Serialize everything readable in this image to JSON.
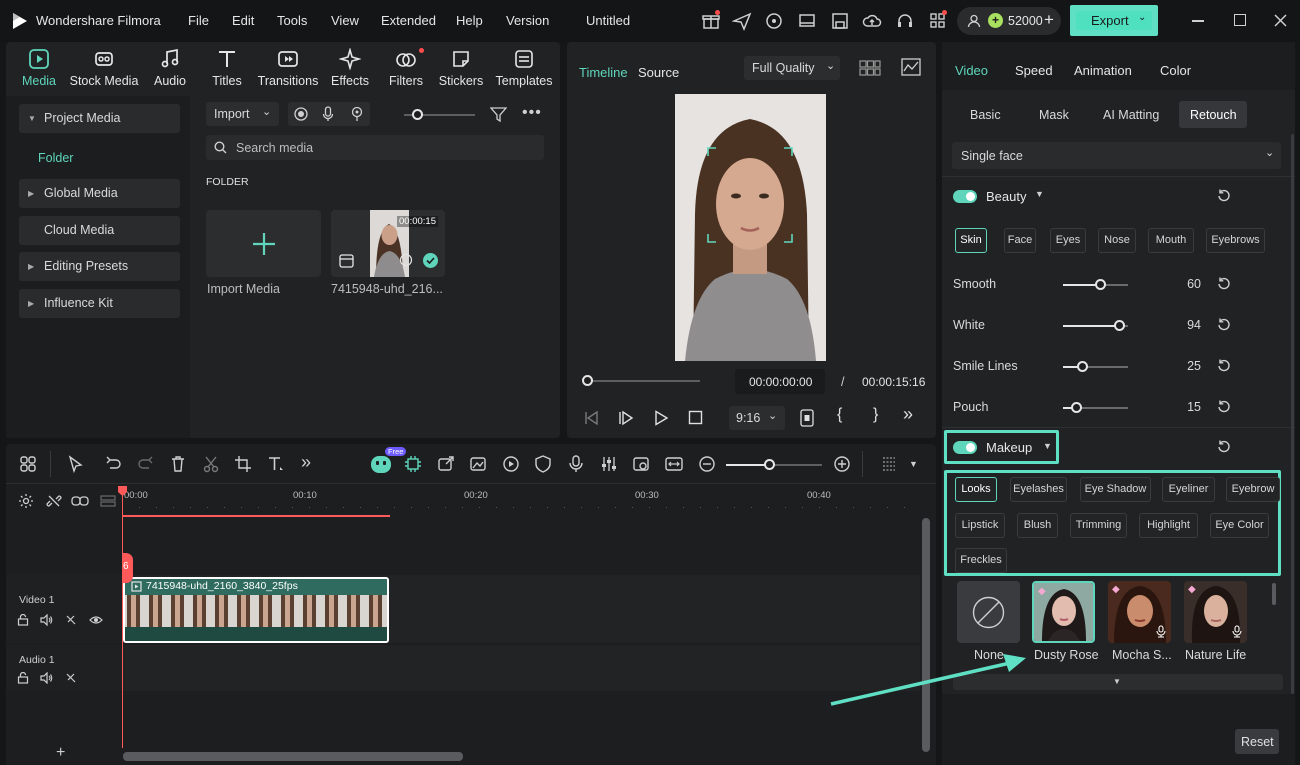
{
  "app": {
    "name": "Wondershare Filmora",
    "project_title": "Untitled",
    "credits": "52000"
  },
  "menu": [
    "File",
    "Edit",
    "Tools",
    "View",
    "Extended",
    "Help",
    "Version"
  ],
  "export_label": "Export",
  "tools": [
    "Media",
    "Stock Media",
    "Audio",
    "Titles",
    "Transitions",
    "Effects",
    "Filters",
    "Stickers",
    "Templates"
  ],
  "sidebar": {
    "items": [
      {
        "label": "Project Media"
      },
      {
        "label": "Folder"
      },
      {
        "label": "Global Media"
      },
      {
        "label": "Cloud Media"
      },
      {
        "label": "Editing Presets"
      },
      {
        "label": "Influence Kit"
      }
    ]
  },
  "media": {
    "import_label": "Import",
    "search_placeholder": "Search media",
    "folder_heading": "FOLDER",
    "import_tile_label": "Import Media",
    "clip_name": "7415948-uhd_216...",
    "clip_duration": "00:00:15"
  },
  "preview": {
    "tab_timeline": "Timeline",
    "tab_source": "Source",
    "quality": "Full Quality",
    "current_time": "00:00:00:00",
    "separator": "/",
    "total_time": "00:00:15:16",
    "aspect": "9:16",
    "progress": 0
  },
  "properties": {
    "tabs": [
      "Video",
      "Speed",
      "Animation",
      "Color"
    ],
    "subtabs": [
      "Basic",
      "Mask",
      "AI Matting",
      "Retouch"
    ],
    "face_mode": "Single face",
    "beauty": {
      "label": "Beauty",
      "chips": [
        "Skin",
        "Face",
        "Eyes",
        "Nose",
        "Mouth",
        "Eyebrows"
      ],
      "sliders": [
        {
          "label": "Smooth",
          "value": "60",
          "pct": 60
        },
        {
          "label": "White",
          "value": "94",
          "pct": 94
        },
        {
          "label": "Smile Lines",
          "value": "25",
          "pct": 25
        },
        {
          "label": "Pouch",
          "value": "15",
          "pct": 15
        }
      ]
    },
    "makeup": {
      "label": "Makeup",
      "chips_row1": [
        "Looks",
        "Eyelashes",
        "Eye Shadow",
        "Eyeliner",
        "Eyebrow"
      ],
      "chips_row2": [
        "Lipstick",
        "Blush",
        "Trimming",
        "Highlight",
        "Eye Color"
      ],
      "chips_row3": [
        "Freckles"
      ],
      "looks": [
        "None",
        "Dusty Rose",
        "Mocha S...",
        "Nature Life"
      ]
    },
    "reset_label": "Reset"
  },
  "timeline": {
    "free_badge": "Free",
    "ruler": [
      "00:00",
      "00:10",
      "00:20",
      "00:30",
      "00:40"
    ],
    "video_track": "Video 1",
    "audio_track": "Audio 1",
    "clip_label": "7415948-uhd_2160_3840_25fps",
    "playhead_marker": "6"
  },
  "colors": {
    "accent": "#5fd6bc",
    "highlight": "#5fe0c4",
    "playhead": "#ff5a5a"
  }
}
